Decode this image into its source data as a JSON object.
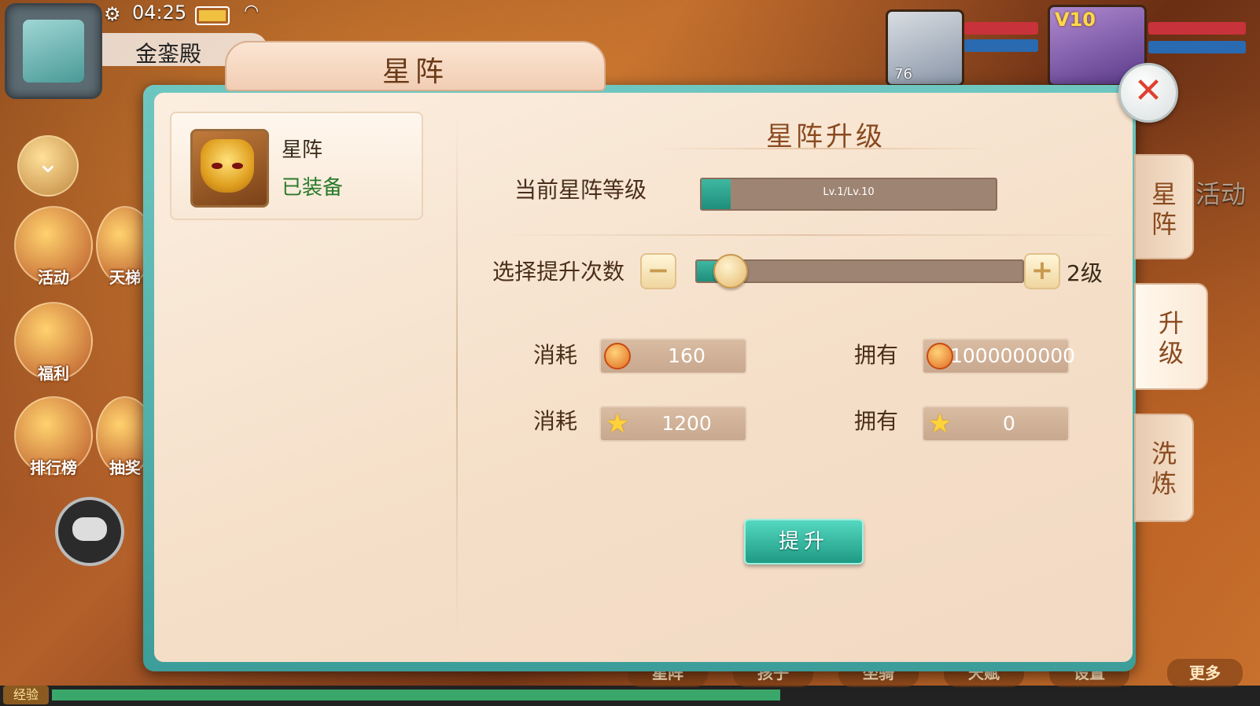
{
  "status_bar": {
    "time": "04:25"
  },
  "location": {
    "name": "金銮殿"
  },
  "hud": {
    "side_buttons": [
      "活动",
      "福利",
      "排行榜",
      "天梯",
      "抽奖"
    ],
    "exp_label": "经验",
    "bottom_menu": [
      "星阵",
      "孩子",
      "坐骑",
      "天赋",
      "设置",
      "更多"
    ],
    "portraits": [
      {
        "level": "76"
      },
      {
        "vip": "V10"
      }
    ],
    "right_activity": "活动"
  },
  "panel": {
    "title": "星阵",
    "close_icon": "close-icon",
    "item": {
      "name": "星阵",
      "status": "已装备",
      "icon": "golden-mask-icon"
    },
    "section_title": "星阵升级",
    "current_level": {
      "label": "当前星阵等级",
      "text": "Lv.1/Lv.10",
      "current": 1,
      "max": 10
    },
    "upgrade_count": {
      "label": "选择提升次数",
      "minus": "−",
      "plus": "+",
      "value_text": "2级",
      "slider_fraction": 0.1
    },
    "costs": [
      {
        "cost_label": "消耗",
        "cost_value": "160",
        "own_label": "拥有",
        "own_value": "1000000000",
        "icon": "coin-icon"
      },
      {
        "cost_label": "消耗",
        "cost_value": "1200",
        "own_label": "拥有",
        "own_value": "0",
        "icon": "star-icon"
      }
    ],
    "upgrade_button": "提升",
    "side_tabs": [
      {
        "label": "星阵",
        "active": false
      },
      {
        "label": "升级",
        "active": true
      },
      {
        "label": "洗炼",
        "active": false
      }
    ]
  },
  "colors": {
    "accent_teal": "#1e9a84",
    "panel_bg": "#f5dfc8",
    "close_red": "#e04030"
  }
}
